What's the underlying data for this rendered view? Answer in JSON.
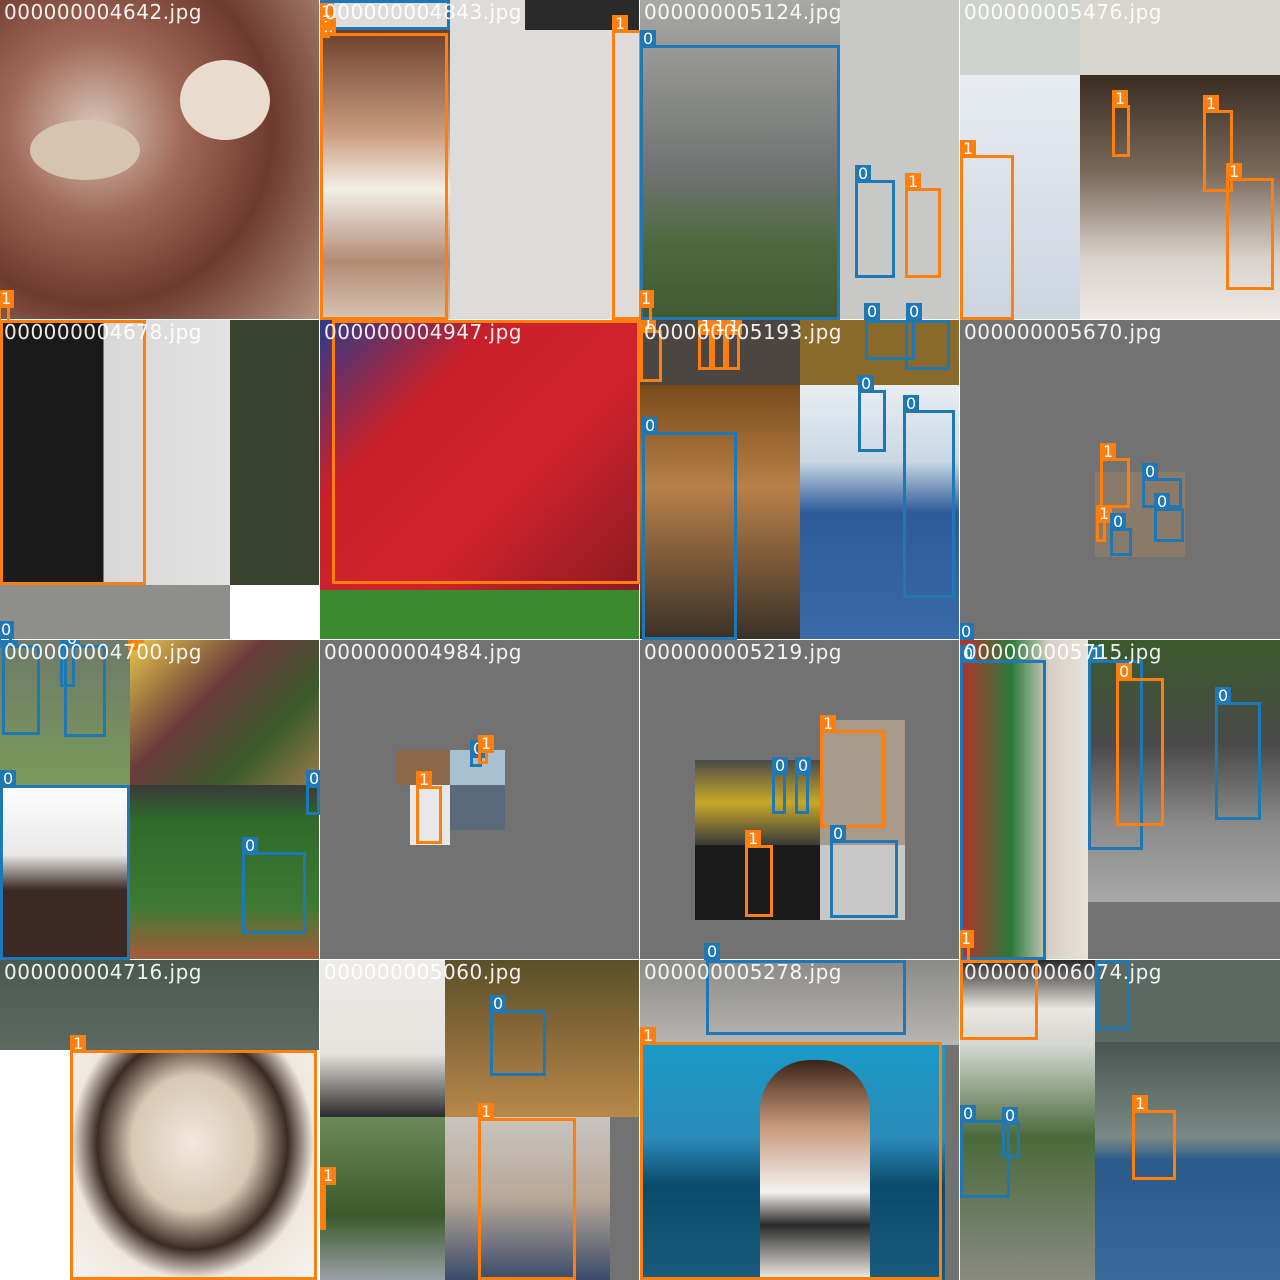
{
  "colors": {
    "class_0": "#1f77b4",
    "class_1": "#ff7f0e",
    "letterbox": "#727272",
    "filename_text": "#ffffff"
  },
  "tiles": [
    {
      "filename": "000000004642.jpg",
      "labels": [
        "1"
      ]
    },
    {
      "filename": "000000004843.jpg",
      "labels": [
        "1",
        "1",
        "1"
      ]
    },
    {
      "filename": "000000005124.jpg",
      "labels": [
        "0",
        "0",
        "1",
        "1",
        "0",
        "0"
      ]
    },
    {
      "filename": "000000005476.jpg",
      "labels": [
        "1",
        "1",
        "1",
        "1"
      ]
    },
    {
      "filename": "000000004678.jpg",
      "labels": [
        "1",
        "0"
      ]
    },
    {
      "filename": "000000004947.jpg",
      "labels": [
        "1"
      ]
    },
    {
      "filename": "000000005193.jpg",
      "labels": [
        "1",
        "1",
        "1",
        "1",
        "0",
        "0",
        "0",
        "0",
        "0"
      ]
    },
    {
      "filename": "000000005670.jpg",
      "labels": [
        "1",
        "0",
        "1",
        "0",
        "0",
        "0"
      ]
    },
    {
      "filename": "000000004700.jpg",
      "labels": [
        "0",
        "0",
        "0",
        "1",
        "0",
        "0",
        "0",
        "0"
      ]
    },
    {
      "filename": "000000004984.jpg",
      "labels": [
        "0",
        "1",
        "1"
      ]
    },
    {
      "filename": "000000005219.jpg",
      "labels": [
        "1",
        "0",
        "0",
        "1",
        "0",
        "0"
      ]
    },
    {
      "filename": "000000005715.jpg",
      "labels": [
        "1",
        "0",
        "0",
        "0",
        "1"
      ]
    },
    {
      "filename": "000000004716.jpg",
      "labels": [
        "1"
      ]
    },
    {
      "filename": "000000005060.jpg",
      "labels": [
        "0",
        "1",
        "1"
      ]
    },
    {
      "filename": "000000005278.jpg",
      "labels": [
        "0",
        "1"
      ]
    },
    {
      "filename": "000000006074.jpg",
      "labels": [
        "1",
        "0",
        "0",
        "0"
      ]
    }
  ]
}
